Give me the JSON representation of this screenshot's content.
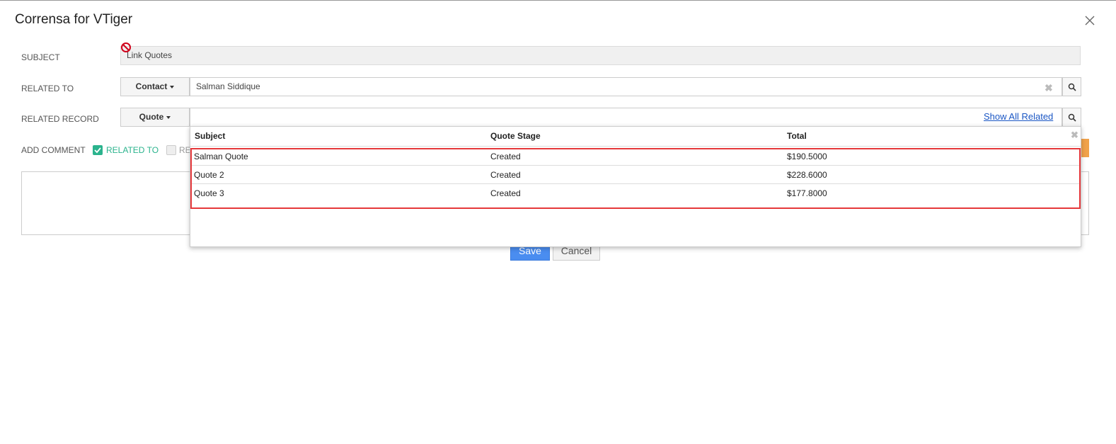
{
  "dialog": {
    "title": "Corrensa for VTiger"
  },
  "form": {
    "subject": {
      "label": "SUBJECT",
      "value": "Link Quotes"
    },
    "related_to": {
      "label": "RELATED TO",
      "type": "Contact",
      "value": "Salman Siddique"
    },
    "related_record": {
      "label": "RELATED RECORD",
      "type": "Quote",
      "value": "",
      "show_all_link": "Show All Related"
    },
    "add_comment": {
      "label": "ADD COMMENT",
      "related_to_checkbox": "RELATED TO",
      "related_to_checked": true,
      "second_checkbox_partial": "RE",
      "second_checked": false
    }
  },
  "dropdown": {
    "columns": [
      "Subject",
      "Quote Stage",
      "Total"
    ],
    "rows": [
      {
        "subject": "Salman Quote",
        "stage": "Created",
        "total": "$190.5000"
      },
      {
        "subject": "Quote 2",
        "stage": "Created",
        "total": "$228.6000"
      },
      {
        "subject": "Quote 3",
        "stage": "Created",
        "total": "$177.8000"
      }
    ]
  },
  "buttons": {
    "save": "Save",
    "cancel": "Cancel"
  },
  "colors": {
    "accent_green": "#2bb38d",
    "primary_blue": "#4a8df0",
    "highlight_red": "#e5383b",
    "link_blue": "#1a56c4"
  }
}
